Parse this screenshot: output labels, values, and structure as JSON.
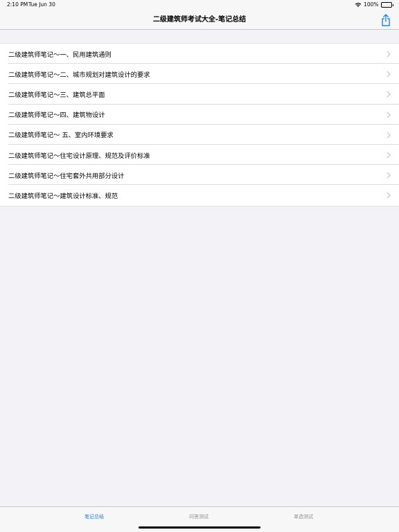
{
  "status_bar": {
    "time": "2:10 PM",
    "date": "Tue Jun 30",
    "battery": "100%",
    "icons": [
      "wifi-icon",
      "battery-icon"
    ]
  },
  "nav": {
    "title": "二级建筑师考试大全-笔记总结",
    "share_icon": "share-icon"
  },
  "list": {
    "items": [
      {
        "label": "二级建筑师笔记～一、民用建筑通则"
      },
      {
        "label": "二级建筑师笔记～二、城市规划对建筑设计的要求"
      },
      {
        "label": "二级建筑师笔记～三、建筑总平面"
      },
      {
        "label": "二级建筑师笔记～四、建筑物设计"
      },
      {
        "label": "二级建筑师笔记～ 五、室内环境要求"
      },
      {
        "label": "二级建筑师笔记～住宅设计原理、规范及评价标准"
      },
      {
        "label": "二级建筑师笔记～住宅套外共用部分设计"
      },
      {
        "label": "二级建筑师笔记～建筑设计标准、规范"
      }
    ]
  },
  "tab_bar": {
    "tabs": [
      {
        "label": "笔记总结",
        "active": true
      },
      {
        "label": "问答测试",
        "active": false
      },
      {
        "label": "单选测试",
        "active": false
      }
    ]
  },
  "colors": {
    "accent": "#1a82fb",
    "background": "#f2f2f7",
    "inactive_tab": "#8e8e93"
  }
}
